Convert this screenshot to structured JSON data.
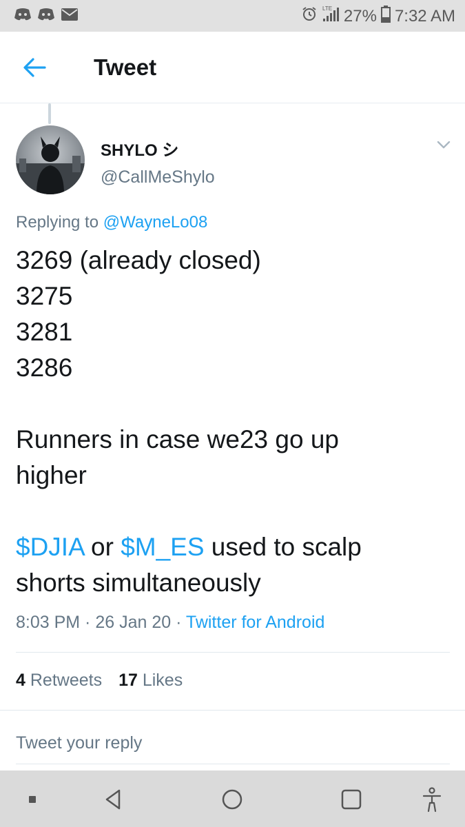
{
  "status_bar": {
    "battery": "27%",
    "time": "7:32 AM",
    "network": "LTE",
    "left_icons": [
      "discord-icon",
      "discord-icon",
      "mail-icon"
    ],
    "right_icons": [
      "alarm-icon",
      "signal-icon",
      "battery-icon"
    ]
  },
  "header": {
    "title": "Tweet",
    "back_icon": "back-arrow-icon"
  },
  "tweet": {
    "display_name": "SHYLO シ",
    "handle": "@CallMeShylo",
    "replying_prefix": "Replying to",
    "replying_to": "@WayneLo08",
    "lines": [
      "3269 (already closed)",
      "3275",
      "3281",
      "3286",
      "",
      "Runners in case we23 go up",
      "higher",
      ""
    ],
    "cashtag_line": {
      "tag1": "$DJIA",
      "mid": " or ",
      "tag2": "$M_ES",
      "rest": " used to scalp"
    },
    "last_line": "shorts simultaneously",
    "time": "8:03 PM",
    "sep1": " · ",
    "date": "26 Jan 20",
    "sep2": " · ",
    "source": "Twitter for Android"
  },
  "stats": {
    "retweets_count": "4",
    "retweets_label": "Retweets",
    "likes_count": "17",
    "likes_label": "Likes"
  },
  "reply": {
    "placeholder": "Tweet your reply"
  },
  "colors": {
    "accent": "#1da1f2",
    "muted": "#657786",
    "text": "#14171a"
  }
}
